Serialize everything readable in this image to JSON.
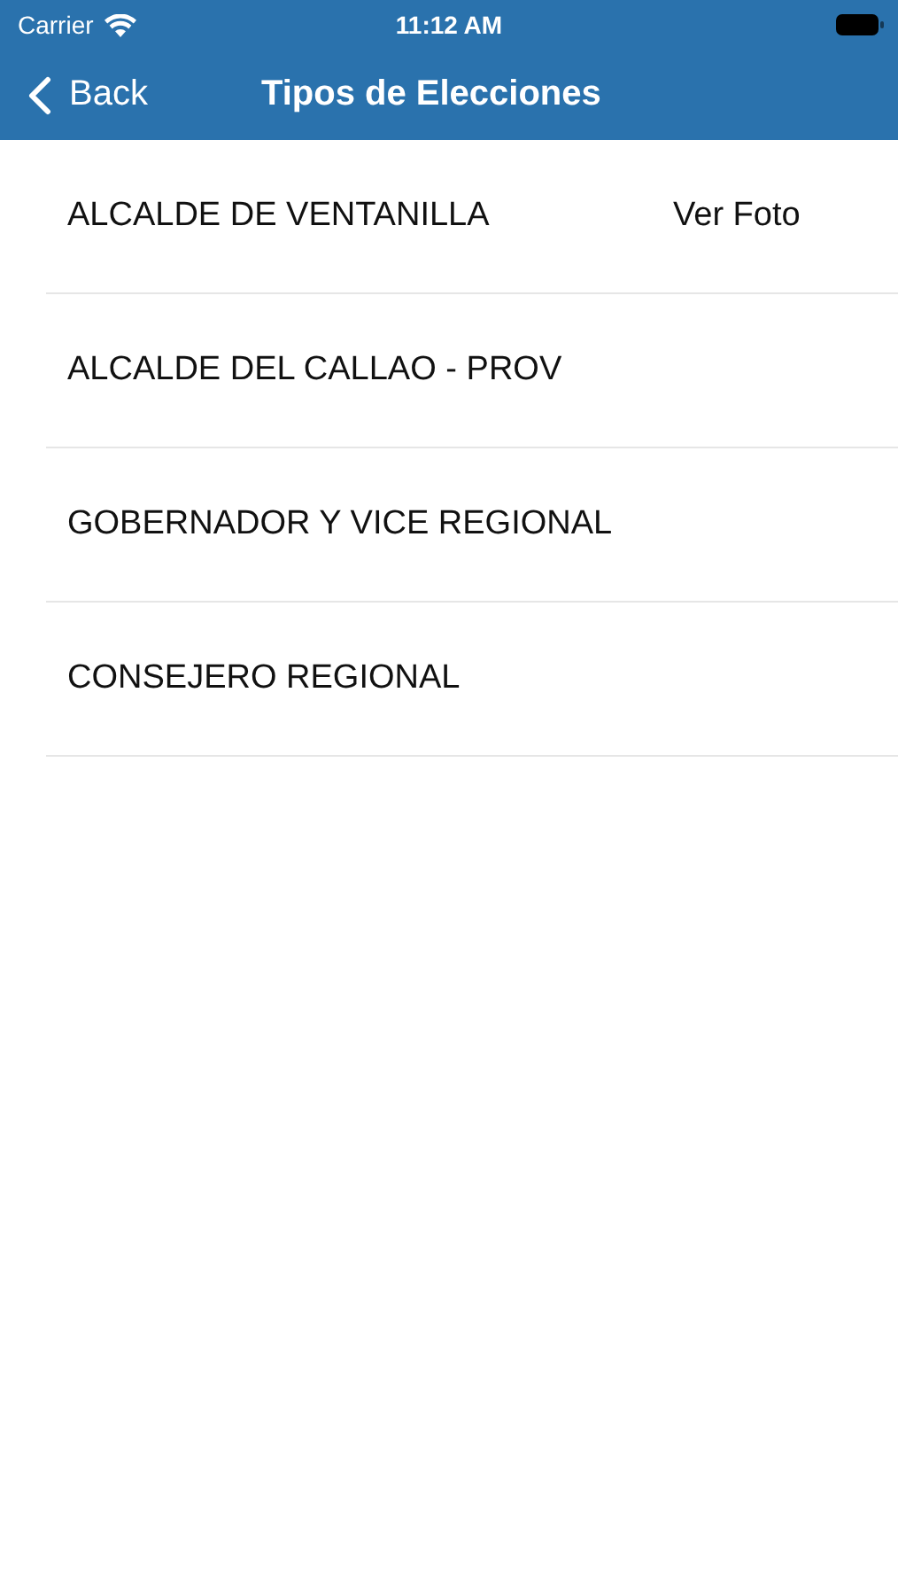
{
  "status_bar": {
    "carrier": "Carrier",
    "time": "11:12 AM"
  },
  "nav_bar": {
    "back": "Back",
    "title": "Tipos de Elecciones"
  },
  "rows": [
    {
      "label": "ALCALDE DE VENTANILLA",
      "action": "Ver Foto"
    },
    {
      "label": "ALCALDE DEL CALLAO - PROV"
    },
    {
      "label": "GOBERNADOR Y VICE REGIONAL"
    },
    {
      "label": "CONSEJERO REGIONAL"
    }
  ]
}
